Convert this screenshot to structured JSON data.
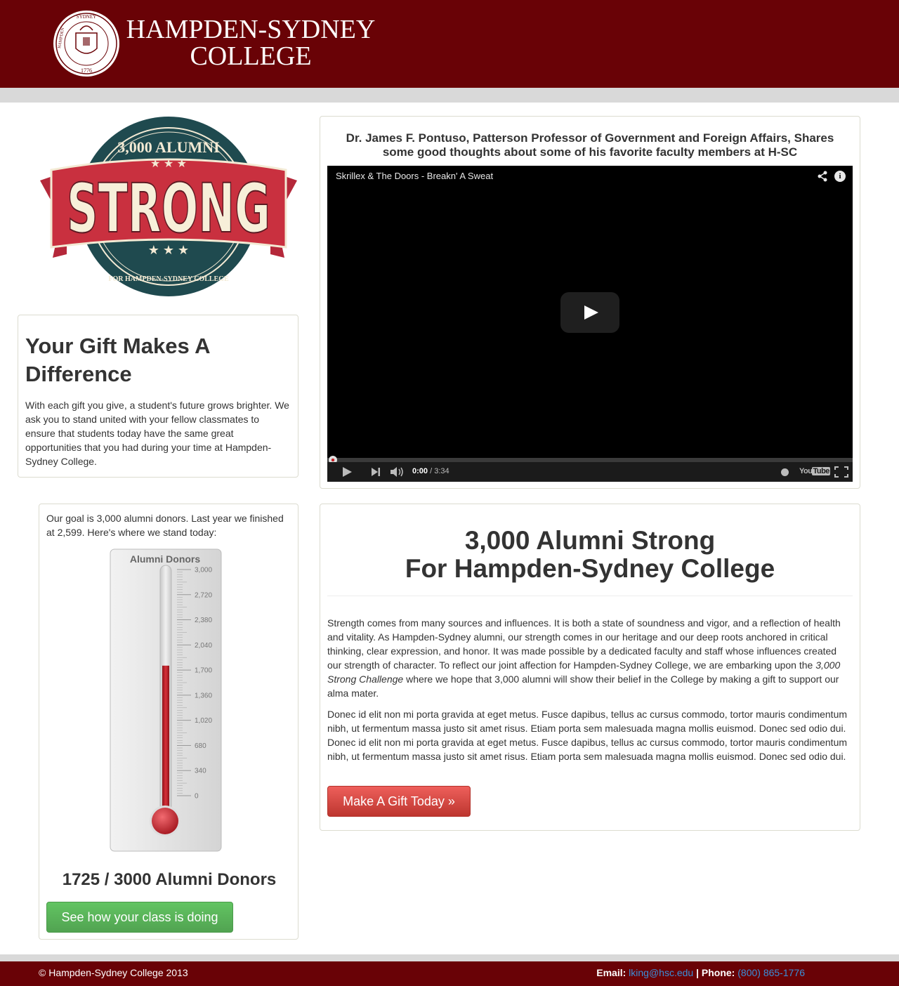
{
  "header": {
    "brand_line1": "HAMPDEN-SYDNEY",
    "brand_line2": "COLLEGE",
    "seal_text_top": "SYDNEY",
    "seal_text_left": "HAMPDEN",
    "seal_year": "1776",
    "brand_color": "#690206"
  },
  "badge": {
    "top_text": "3,000 ALUMNI",
    "main_text": "STRONG",
    "bottom_text": "FOR HAMPDEN-SYDNEY COLLEGE"
  },
  "gift": {
    "heading": "Your Gift Makes A Difference",
    "body": "With each gift you give, a student's future grows brighter. We ask you to stand united with your fellow classmates to ensure that students today have the same great opportunities that you had during your time at Hampden-Sydney College."
  },
  "video": {
    "heading": "Dr. James F. Pontuso, Patterson Professor of Government and Foreign Affairs, Shares some good thoughts about some of his favorite faculty members at H-SC",
    "player_title": "Skrillex & The Doors - Breakn' A Sweat",
    "current_time": "0:00",
    "duration": "/ 3:34",
    "yt_you": "You",
    "yt_tube": "Tube",
    "info_glyph": "i"
  },
  "thermometer": {
    "intro": "Our goal is 3,000 alumni donors. Last year we finished at 2,599. Here's where we stand today:",
    "label": "Alumni Donors",
    "ticks": [
      "3,000",
      "2,720",
      "2,380",
      "2,040",
      "1,700",
      "1,360",
      "1,020",
      "680",
      "340",
      "0"
    ],
    "current": 1725,
    "goal": 3000,
    "status": "1725 / 3000 Alumni Donors",
    "button": "See how your class is doing"
  },
  "about": {
    "title_line1": "3,000 Alumni Strong",
    "title_line2": "For Hampden-Sydney College",
    "p1_before": "Strength comes from many sources and influences. It is both a state of soundness and vigor, and a reflection of health and vitality. As Hampden-Sydney alumni, our strength comes in our heritage and our deep roots anchored in critical thinking, clear expression, and honor. It was made possible by a dedicated faculty and staff whose influences created our strength of character. To reflect our joint affection for Hampden-Sydney College, we are embarking upon the ",
    "p1_em": "3,000 Strong Challenge",
    "p1_after": " where we hope that 3,000 alumni will show their belief in the College by making a gift to support our alma mater.",
    "p2": "Donec id elit non mi porta gravida at eget metus. Fusce dapibus, tellus ac cursus commodo, tortor mauris condimentum nibh, ut fermentum massa justo sit amet risus. Etiam porta sem malesuada magna mollis euismod. Donec sed odio dui. Donec id elit non mi porta gravida at eget metus. Fusce dapibus, tellus ac cursus commodo, tortor mauris condimentum nibh, ut fermentum massa justo sit amet risus. Etiam porta sem malesuada magna mollis euismod. Donec sed odio dui.",
    "button": "Make A Gift Today »"
  },
  "footer": {
    "copyright": "© Hampden-Sydney College 2013",
    "email_label": "Email:",
    "email": "lking@hsc.edu",
    "separator": "|",
    "phone_label": "Phone:",
    "phone": "(800) 865-1776"
  }
}
